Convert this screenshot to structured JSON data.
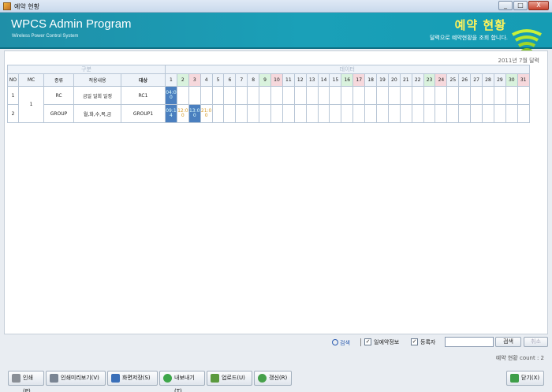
{
  "window": {
    "title": "예약 현황",
    "controls": [
      "_",
      "□",
      "X"
    ]
  },
  "header": {
    "app_name": "WPCS Admin Program",
    "app_sub": "Wireless Power Control System",
    "page_title": "예약 현황",
    "page_desc": "달력으로 예약현황을 조회 합니다."
  },
  "calendar": {
    "month_label": "2011년 7월 달력",
    "group_left": "구분",
    "group_right": "데이터",
    "columns": {
      "no": "NO",
      "mc": "MC",
      "type": "종류",
      "content": "적용내용",
      "target": "대상"
    },
    "days": [
      "1",
      "2",
      "3",
      "4",
      "5",
      "6",
      "7",
      "8",
      "9",
      "10",
      "11",
      "12",
      "13",
      "14",
      "15",
      "16",
      "17",
      "18",
      "19",
      "20",
      "21",
      "22",
      "23",
      "24",
      "25",
      "26",
      "27",
      "28",
      "29",
      "30",
      "31"
    ],
    "saturdays": [
      2,
      9,
      16,
      23,
      30
    ],
    "sundays": [
      3,
      10,
      17,
      24,
      31
    ],
    "rows": [
      {
        "no": "1",
        "type": "RC",
        "content": "금일 일회 일정",
        "target": "RC1",
        "bookings": [
          {
            "day": 1,
            "text": "04:0 0",
            "style": "blue"
          }
        ]
      },
      {
        "no": "2",
        "type": "GROUP",
        "content": "월,화,수,목,금",
        "target": "GROUP1",
        "bookings": [
          {
            "day": 1,
            "text": "09:1 4",
            "style": "blue"
          },
          {
            "day": 2,
            "text": "12:0 0",
            "style": "white"
          },
          {
            "day": 3,
            "text": "13:0 0",
            "style": "blue"
          },
          {
            "day": 4,
            "text": "21:0 0",
            "style": "white"
          }
        ]
      }
    ],
    "mc_value": "1"
  },
  "search": {
    "link_label": "검색",
    "check1_label": "일예약정보",
    "check1_checked": true,
    "check2_label": "등록자",
    "check2_checked": true,
    "input_value": "",
    "search_button": "검색",
    "cancel_button": "취소",
    "count_label": "예약 현황 count : 2"
  },
  "toolbar": {
    "print": "인쇄(P)",
    "preview": "인쇄미리보기(V)",
    "save_screen": "화면저장(S)",
    "export": "내보내기(T)",
    "upload": "업로드(U)",
    "refresh": "갱신(R)",
    "close": "닫기(X)"
  }
}
